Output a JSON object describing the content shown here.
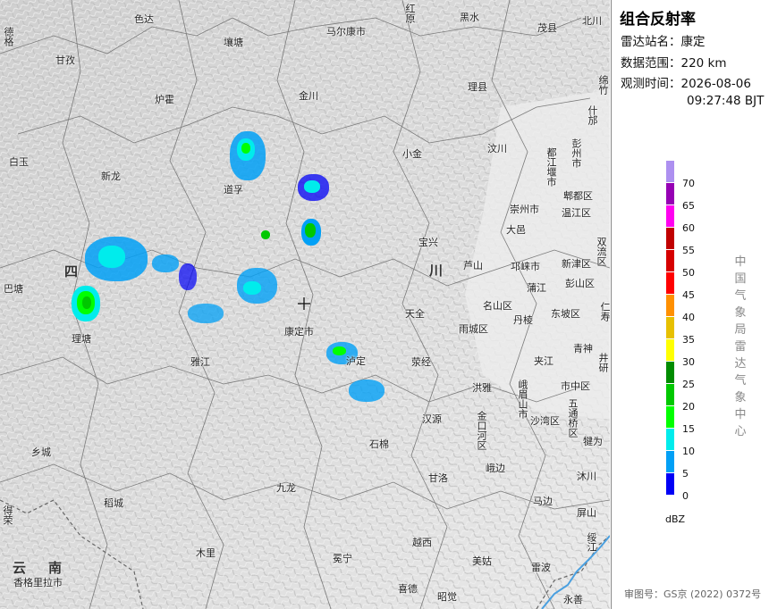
{
  "title": "组合反射率",
  "station": {
    "label": "雷达站名：",
    "value": "康定"
  },
  "range": {
    "label": "数据范围：",
    "value": "220 km"
  },
  "time": {
    "label": "观测时间：",
    "date": "2026-08-06",
    "clock": "09:27:48 BJT"
  },
  "legend": {
    "unit": "dBZ",
    "levels": [
      {
        "label": "70",
        "color": "#ad90f0"
      },
      {
        "label": "65",
        "color": "#9600b4"
      },
      {
        "label": "60",
        "color": "#ff00f0"
      },
      {
        "label": "55",
        "color": "#c00000"
      },
      {
        "label": "50",
        "color": "#d60000"
      },
      {
        "label": "45",
        "color": "#ff0000"
      },
      {
        "label": "40",
        "color": "#ff9000"
      },
      {
        "label": "35",
        "color": "#e7c000"
      },
      {
        "label": "30",
        "color": "#ffff00"
      },
      {
        "label": "25",
        "color": "#008c00"
      },
      {
        "label": "20",
        "color": "#00c800"
      },
      {
        "label": "15",
        "color": "#00ff00"
      },
      {
        "label": "10",
        "color": "#00ecec"
      },
      {
        "label": "5",
        "color": "#01a0f6"
      },
      {
        "label": "0",
        "color": "#0000f6"
      }
    ]
  },
  "center_credit": "中国气象局雷达气象中心",
  "footer": "审图号：GS京 (2022) 0372号",
  "map": {
    "radar_marker": "+",
    "provinces": [
      "四",
      "川",
      "云",
      "南"
    ],
    "places": [
      "德格",
      "色达",
      "壤塘",
      "马尔康市",
      "红原",
      "黑水",
      "茂县",
      "北川",
      "甘孜",
      "炉霍",
      "金川",
      "理县",
      "绵竹",
      "什邡",
      "白玉",
      "新龙",
      "道孚",
      "小金",
      "汶川",
      "彭州市",
      "都江堰市",
      "郫都区",
      "温江区",
      "崇州市",
      "大邑",
      "宝兴",
      "双流区",
      "新津区",
      "芦山",
      "邛崃市",
      "蒲江",
      "彭山区",
      "仁寿",
      "巴塘",
      "理塘",
      "名山区",
      "丹棱",
      "东坡区",
      "雅江",
      "康定市",
      "天全",
      "雨城区",
      "青神",
      "夹江",
      "荥经",
      "泸定",
      "井研",
      "洪雅",
      "峨眉山市",
      "市中区",
      "五通桥区",
      "沙湾区",
      "汉源",
      "金口河区",
      "犍为",
      "乡城",
      "石棉",
      "峨边",
      "沐川",
      "九龙",
      "甘洛",
      "马边",
      "屏山",
      "稻城",
      "得荣",
      "越西",
      "美姑",
      "雷波",
      "木里",
      "冕宁",
      "绥江",
      "香格里拉市",
      "喜德",
      "昭觉",
      "永善"
    ]
  }
}
